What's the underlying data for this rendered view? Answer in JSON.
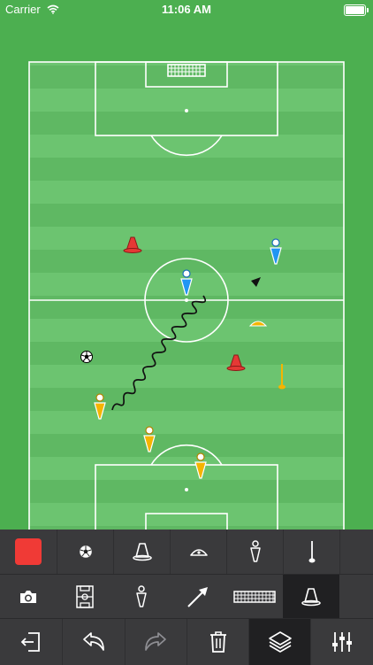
{
  "status_bar": {
    "carrier": "Carrier",
    "time": "11:06 AM",
    "battery_level": 1.0
  },
  "pitch": {
    "colors": {
      "grass_light": "#66bb6a",
      "grass_dark": "#57b05c",
      "lines": "#ffffff"
    },
    "items": [
      {
        "type": "cone",
        "color": "#e53935",
        "label": "red-cone"
      },
      {
        "type": "cone",
        "color": "#e53935",
        "label": "red-cone"
      },
      {
        "type": "player",
        "color": "#2196f3",
        "label": "blue-player"
      },
      {
        "type": "player",
        "color": "#2196f3",
        "label": "blue-player"
      },
      {
        "type": "player",
        "color": "#f5b400",
        "label": "yellow-player"
      },
      {
        "type": "player",
        "color": "#f5b400",
        "label": "yellow-player"
      },
      {
        "type": "player",
        "color": "#f5b400",
        "label": "yellow-player"
      },
      {
        "type": "marker-disc",
        "color": "#f5b400",
        "label": "yellow-disc"
      },
      {
        "type": "pole",
        "color": "#f5b400",
        "label": "yellow-pole"
      },
      {
        "type": "ball",
        "color": "#000000",
        "label": "ball"
      },
      {
        "type": "dribble-arrow",
        "color": "#000000",
        "label": "dribble-arrow"
      }
    ]
  },
  "toolbar": {
    "row1": [
      {
        "name": "color-picker-button",
        "icon": "color-swatch",
        "color": "#f03a36"
      },
      {
        "name": "ball-tool-button",
        "icon": "ball-icon"
      },
      {
        "name": "cone-tool-button",
        "icon": "cone-icon"
      },
      {
        "name": "disc-tool-button",
        "icon": "disc-icon"
      },
      {
        "name": "player-tool-button",
        "icon": "player-icon"
      },
      {
        "name": "pole-tool-button",
        "icon": "pole-icon"
      }
    ],
    "row2": [
      {
        "name": "camera-button",
        "icon": "camera-icon"
      },
      {
        "name": "pitch-button",
        "icon": "pitch-icon"
      },
      {
        "name": "players-button",
        "icon": "player-icon"
      },
      {
        "name": "arrow-button",
        "icon": "arrow-icon"
      },
      {
        "name": "goal-button",
        "icon": "goal-icon"
      },
      {
        "name": "equipment-button",
        "icon": "cone-icon",
        "selected": true
      }
    ],
    "row3": [
      {
        "name": "exit-button",
        "icon": "exit-icon"
      },
      {
        "name": "undo-button",
        "icon": "undo-icon"
      },
      {
        "name": "redo-button",
        "icon": "redo-icon",
        "disabled": true
      },
      {
        "name": "delete-button",
        "icon": "trash-icon"
      },
      {
        "name": "layers-button",
        "icon": "layers-icon",
        "selected": true
      },
      {
        "name": "settings-button",
        "icon": "sliders-icon"
      }
    ]
  }
}
